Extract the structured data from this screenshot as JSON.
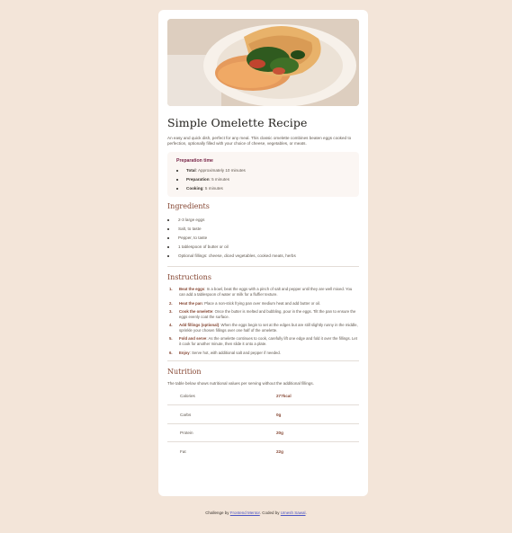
{
  "recipe": {
    "title": "Simple Omelette Recipe",
    "intro": "An easy and quick dish, perfect for any meal. This classic omelette combines beaten eggs cooked to perfection, optionally filled with your choice of cheese, vegetables, or meats."
  },
  "preparation": {
    "title": "Preparation time",
    "items": [
      {
        "label": "Total",
        "text": ": Approximately 10 minutes"
      },
      {
        "label": "Preparation",
        "text": ": 5 minutes"
      },
      {
        "label": "Cooking",
        "text": ": 5 minutes"
      }
    ]
  },
  "ingredients": {
    "title": "Ingredients",
    "items": [
      "2-3 large eggs",
      "Salt, to taste",
      "Pepper, to taste",
      "1 tablespoon of butter or oil",
      "Optional fillings: cheese, diced vegetables, cooked meats, herbs"
    ]
  },
  "instructions": {
    "title": "Instructions",
    "steps": [
      {
        "num": "1.",
        "label": "Beat the eggs",
        "text": ": In a bowl, beat the eggs with a pinch of salt and pepper until they are well mixed. You can add a tablespoon of water or milk for a fluffier texture."
      },
      {
        "num": "2.",
        "label": "Heat the pan",
        "text": ": Place a non-stick frying pan over medium heat and add butter or oil."
      },
      {
        "num": "3.",
        "label": "Cook the omelette",
        "text": ": Once the butter is melted and bubbling, pour in the eggs. Tilt the pan to ensure the eggs evenly coat the surface."
      },
      {
        "num": "4.",
        "label": "Add fillings (optional)",
        "text": ": When the eggs begin to set at the edges but are still slightly runny in the middle, sprinkle your chosen fillings over one half of the omelette."
      },
      {
        "num": "5.",
        "label": "Fold and serve",
        "text": ": As the omelette continues to cook, carefully lift one edge and fold it over the fillings. Let it cook for another minute, then slide it onto a plate."
      },
      {
        "num": "6.",
        "label": "Enjoy",
        "text": ": Serve hot, with additional salt and pepper if needed."
      }
    ]
  },
  "nutrition": {
    "title": "Nutrition",
    "intro": "The table below shows nutritional values per serving without the additional fillings.",
    "rows": [
      {
        "label": "Calories",
        "value": "277kcal"
      },
      {
        "label": "Carbs",
        "value": "0g"
      },
      {
        "label": "Protein",
        "value": "20g"
      },
      {
        "label": "Fat",
        "value": "22g"
      }
    ]
  },
  "footer": {
    "prefix": "Challenge by ",
    "link1": "Frontend Mentor",
    "middle": ". Coded by ",
    "link2": "Umesh Sawal",
    "suffix": "."
  },
  "colors": {
    "background": "#f3e5d9",
    "accent_brown": "#854632",
    "accent_rose": "#7a284a",
    "link": "#4b55c4"
  },
  "icons": {
    "hero_image": "omelette-plate-photo"
  }
}
